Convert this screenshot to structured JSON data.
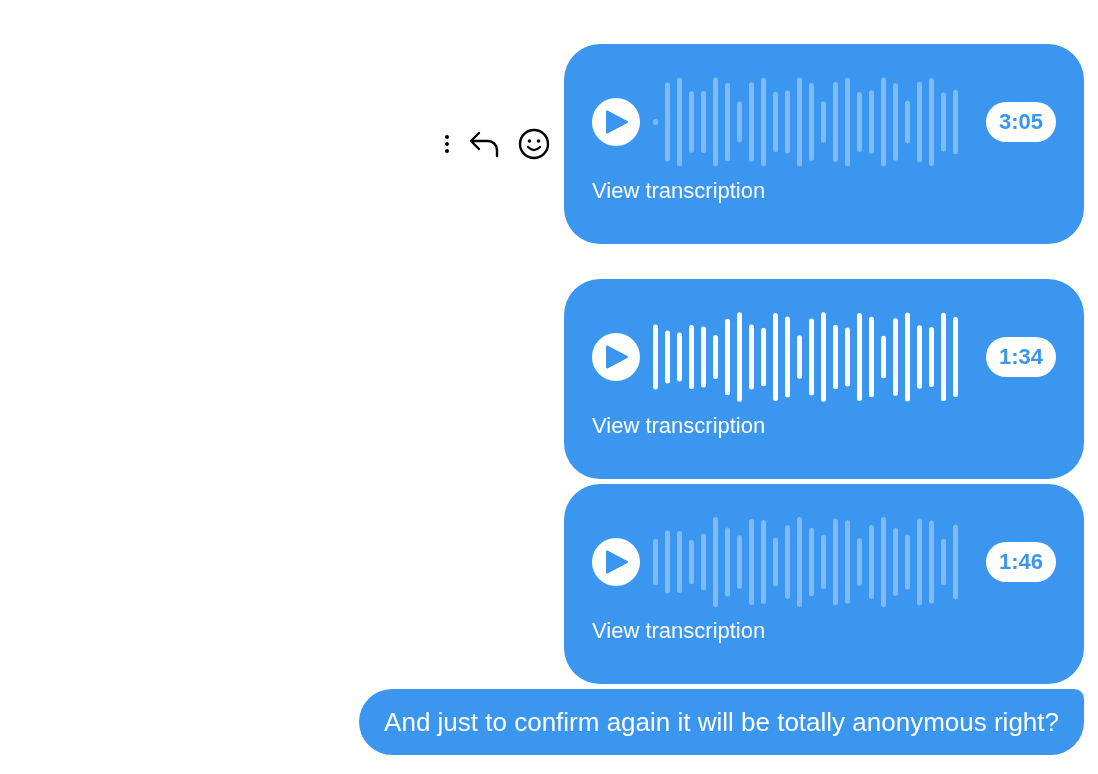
{
  "messages": [
    {
      "kind": "voice",
      "played": false,
      "duration": "3:05",
      "link": "View transcription"
    },
    {
      "kind": "voice",
      "played": true,
      "duration": "1:34",
      "link": "View transcription"
    },
    {
      "kind": "voice",
      "played": false,
      "duration": "1:46",
      "link": "View transcription"
    },
    {
      "kind": "text",
      "text": "And just to confirm again it will be totally anonymous right?"
    }
  ]
}
